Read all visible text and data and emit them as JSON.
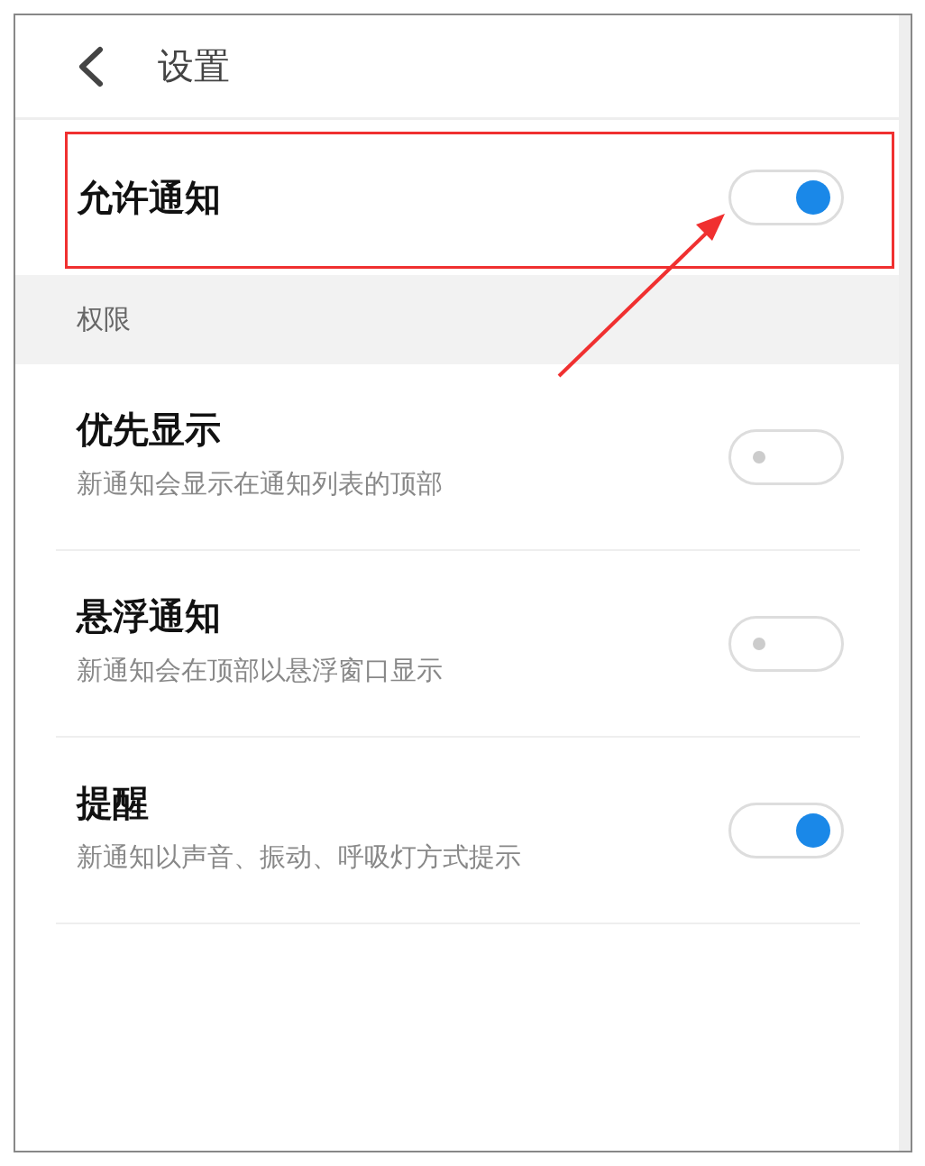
{
  "header": {
    "title": "设置"
  },
  "notifications": {
    "label": "允许通知",
    "on": true,
    "highlighted": true
  },
  "section": {
    "title": "权限"
  },
  "settings": [
    {
      "title": "优先显示",
      "subtitle": "新通知会显示在通知列表的顶部",
      "on": false
    },
    {
      "title": "悬浮通知",
      "subtitle": "新通知会在顶部以悬浮窗口显示",
      "on": false
    },
    {
      "title": "提醒",
      "subtitle": "新通知以声音、振动、呼吸灯方式提示",
      "on": true
    }
  ]
}
